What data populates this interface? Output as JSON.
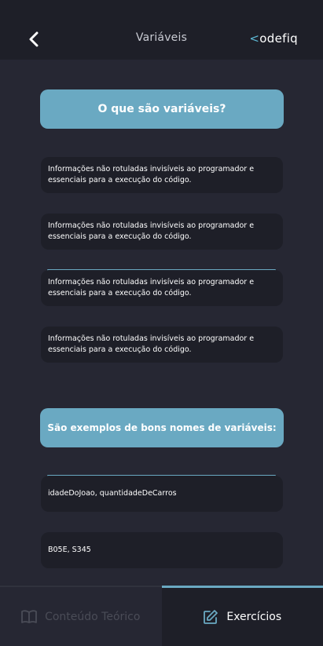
{
  "header": {
    "title": "Variáveis",
    "logo_accent": "<",
    "logo_text": "odefiq",
    "back_icon": "chevron-left-icon"
  },
  "questions": [
    {
      "title": "O que são variáveis?",
      "options": [
        "Informações não rotuladas invisíveis ao programador e essenciais para a execução do código.",
        "Informações não rotuladas invisíveis ao programador e essenciais para a execução do código.",
        "Informações não rotuladas invisíveis ao programador e essenciais para a execução do código.",
        "Informações não rotuladas invisíveis ao programador e essenciais para a execução do código."
      ],
      "selected_index": 2
    },
    {
      "title": "São exemplos de bons nomes de variáveis:",
      "options": [
        "idadeDoJoao, quantidadeDeCarros",
        "B05E, S345"
      ],
      "selected_index": 0
    }
  ],
  "bottom_nav": {
    "tabs": [
      {
        "label": "Conteúdo Teórico",
        "icon": "book-icon",
        "active": false
      },
      {
        "label": "Exercícios",
        "icon": "edit-icon",
        "active": true
      }
    ]
  },
  "colors": {
    "background": "#262733",
    "surface": "#1e1f28",
    "accent": "#6aa9c2",
    "logo_accent": "#5ebad6"
  }
}
